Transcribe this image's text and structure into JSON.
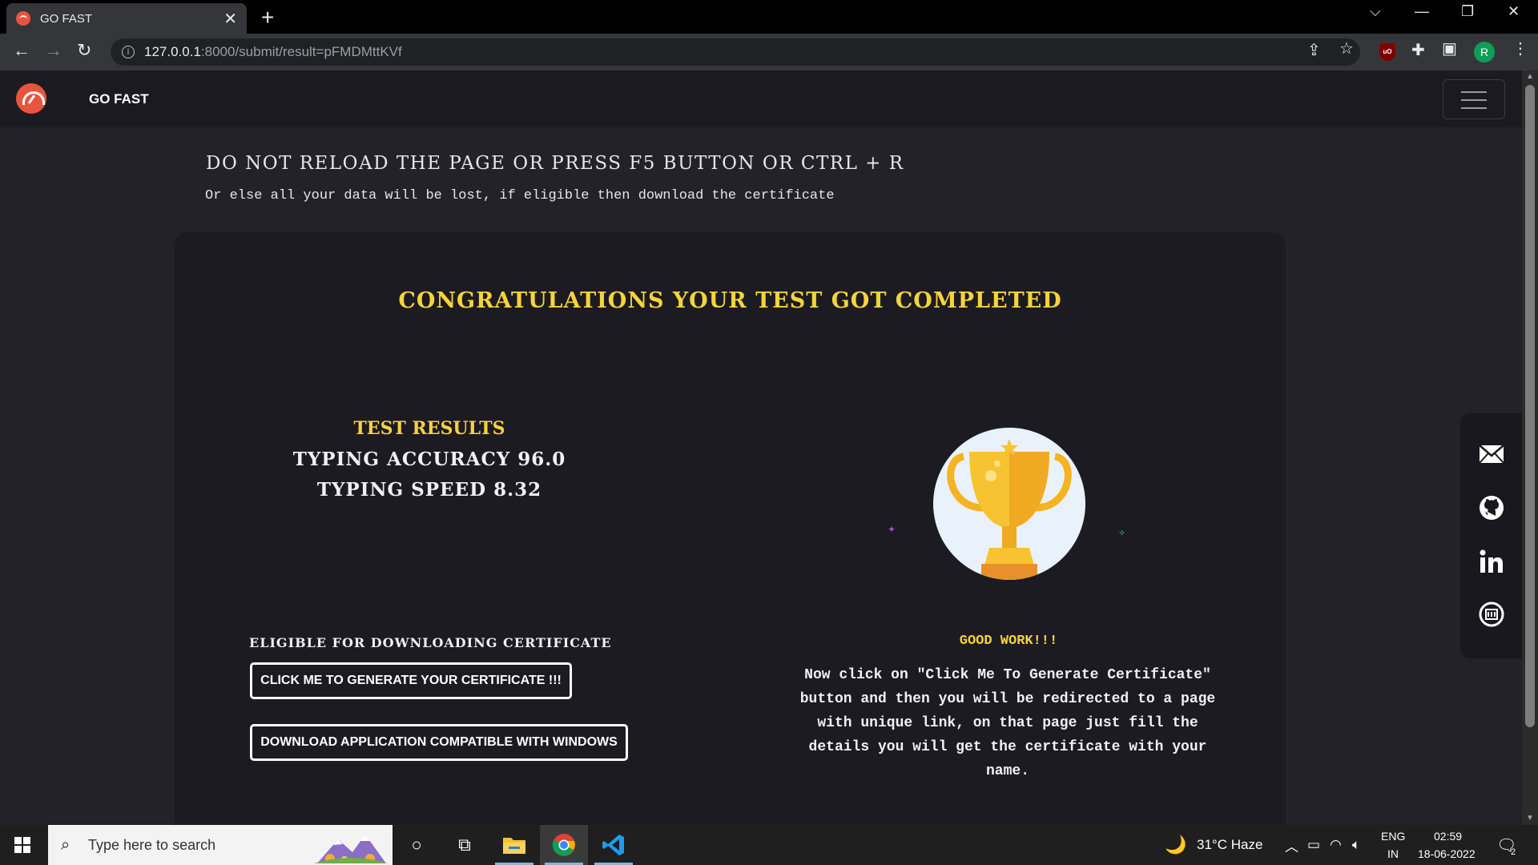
{
  "browser": {
    "tab_title": "GO FAST",
    "tab_close": "✕",
    "new_tab": "+",
    "url_host": "127.0.0.1",
    "url_path": ":8000/submit/result=pFMDMttKVf"
  },
  "navbar": {
    "brand": "GO FAST"
  },
  "warning": {
    "title": "DO NOT RELOAD THE PAGE OR PRESS F5 BUTTON OR CTRL + R",
    "subtitle": "Or else all your data will be lost, if eligible then download the certificate"
  },
  "card": {
    "congrats": "CONGRATULATIONS YOUR TEST GOT COMPLETED",
    "results_title": "TEST RESULTS",
    "accuracy_line": "TYPING ACCURACY 96.0",
    "speed_line": "TYPING SPEED 8.32",
    "eligible_text": "ELIGIBLE FOR DOWNLOADING CERTIFICATE",
    "generate_button": "CLICK ME TO GENERATE YOUR CERTIFICATE !!!",
    "download_button": "DOWNLOAD APPLICATION COMPATIBLE WITH WINDOWS",
    "good_work": "GOOD WORK!!!",
    "instructions": "Now click on \"Click Me To Generate Certificate\" button and then you will be redirected to a page with unique link, on that page just fill the details you will get the certificate with your name."
  },
  "social": {
    "icons": [
      "mail-icon",
      "github-icon",
      "linkedin-icon",
      "portfolio-icon"
    ]
  },
  "taskbar": {
    "search_placeholder": "Type here to search",
    "weather": "31°C  Haze",
    "lang_top": "ENG",
    "lang_bottom": "IN",
    "time": "02:59",
    "date": "18-06-2022",
    "notifications": "2"
  },
  "profile_initial": "R",
  "colors": {
    "accent_yellow": "#f5d33b",
    "page_bg": "#232129",
    "card_bg": "#1c1b22",
    "logo_red": "#e8543d"
  }
}
